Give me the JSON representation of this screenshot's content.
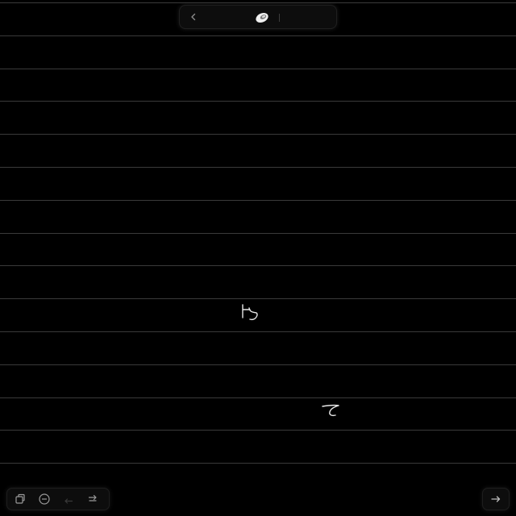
{
  "app": {
    "background_color": "#000000",
    "rule_color": "#3a3a3a",
    "ink_color": "#e8e8e8"
  },
  "top_toolbar": {
    "back_icon": "chevron-left-icon",
    "active_tool_icon": "eraser-icon"
  },
  "canvas": {
    "strokes": [
      {
        "name": "handwritten-character-1",
        "glyph": "ち"
      },
      {
        "name": "handwritten-character-2",
        "glyph": "て"
      }
    ]
  },
  "bottom_toolbar": {
    "buttons": [
      {
        "name": "pages-button",
        "icon": "pages-icon",
        "enabled": true
      },
      {
        "name": "zoom-out-button",
        "icon": "zoom-out-icon",
        "enabled": true
      },
      {
        "name": "undo-button",
        "icon": "undo-icon",
        "enabled": false
      },
      {
        "name": "redo-button",
        "icon": "redo-icon",
        "enabled": true
      }
    ],
    "next_icon": "arrow-right-icon"
  }
}
